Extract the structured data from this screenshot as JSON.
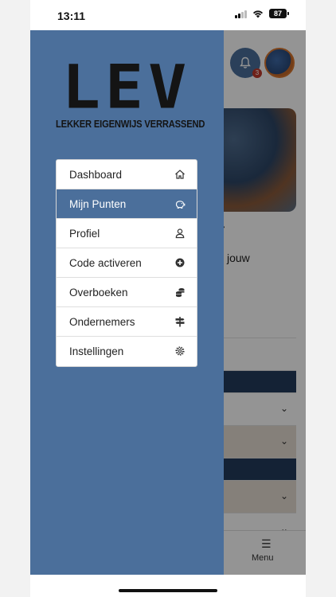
{
  "status_bar": {
    "time": "13:11",
    "battery": "87"
  },
  "app": {
    "notification_count": "3",
    "body_text": "l jouw",
    "bottom_nav": {
      "menu_label": "Menu"
    }
  },
  "logo": {
    "title": "LEV",
    "tagline": "LEKKER EIGENWIJS VERRASSEND"
  },
  "menu": {
    "items": [
      {
        "label": "Dashboard",
        "icon": "home-icon"
      },
      {
        "label": "Mijn Punten",
        "icon": "piggy-bank-icon",
        "active": true
      },
      {
        "label": "Profiel",
        "icon": "user-icon"
      },
      {
        "label": "Code activeren",
        "icon": "plus-circle-icon"
      },
      {
        "label": "Overboeken",
        "icon": "coins-icon"
      },
      {
        "label": "Ondernemers",
        "icon": "signpost-icon"
      },
      {
        "label": "Instellingen",
        "icon": "gear-icon"
      }
    ]
  },
  "colors": {
    "drawer": "#4b6f9b",
    "active_item": "#4b6f9b",
    "accent_orange": "#d9772f"
  }
}
